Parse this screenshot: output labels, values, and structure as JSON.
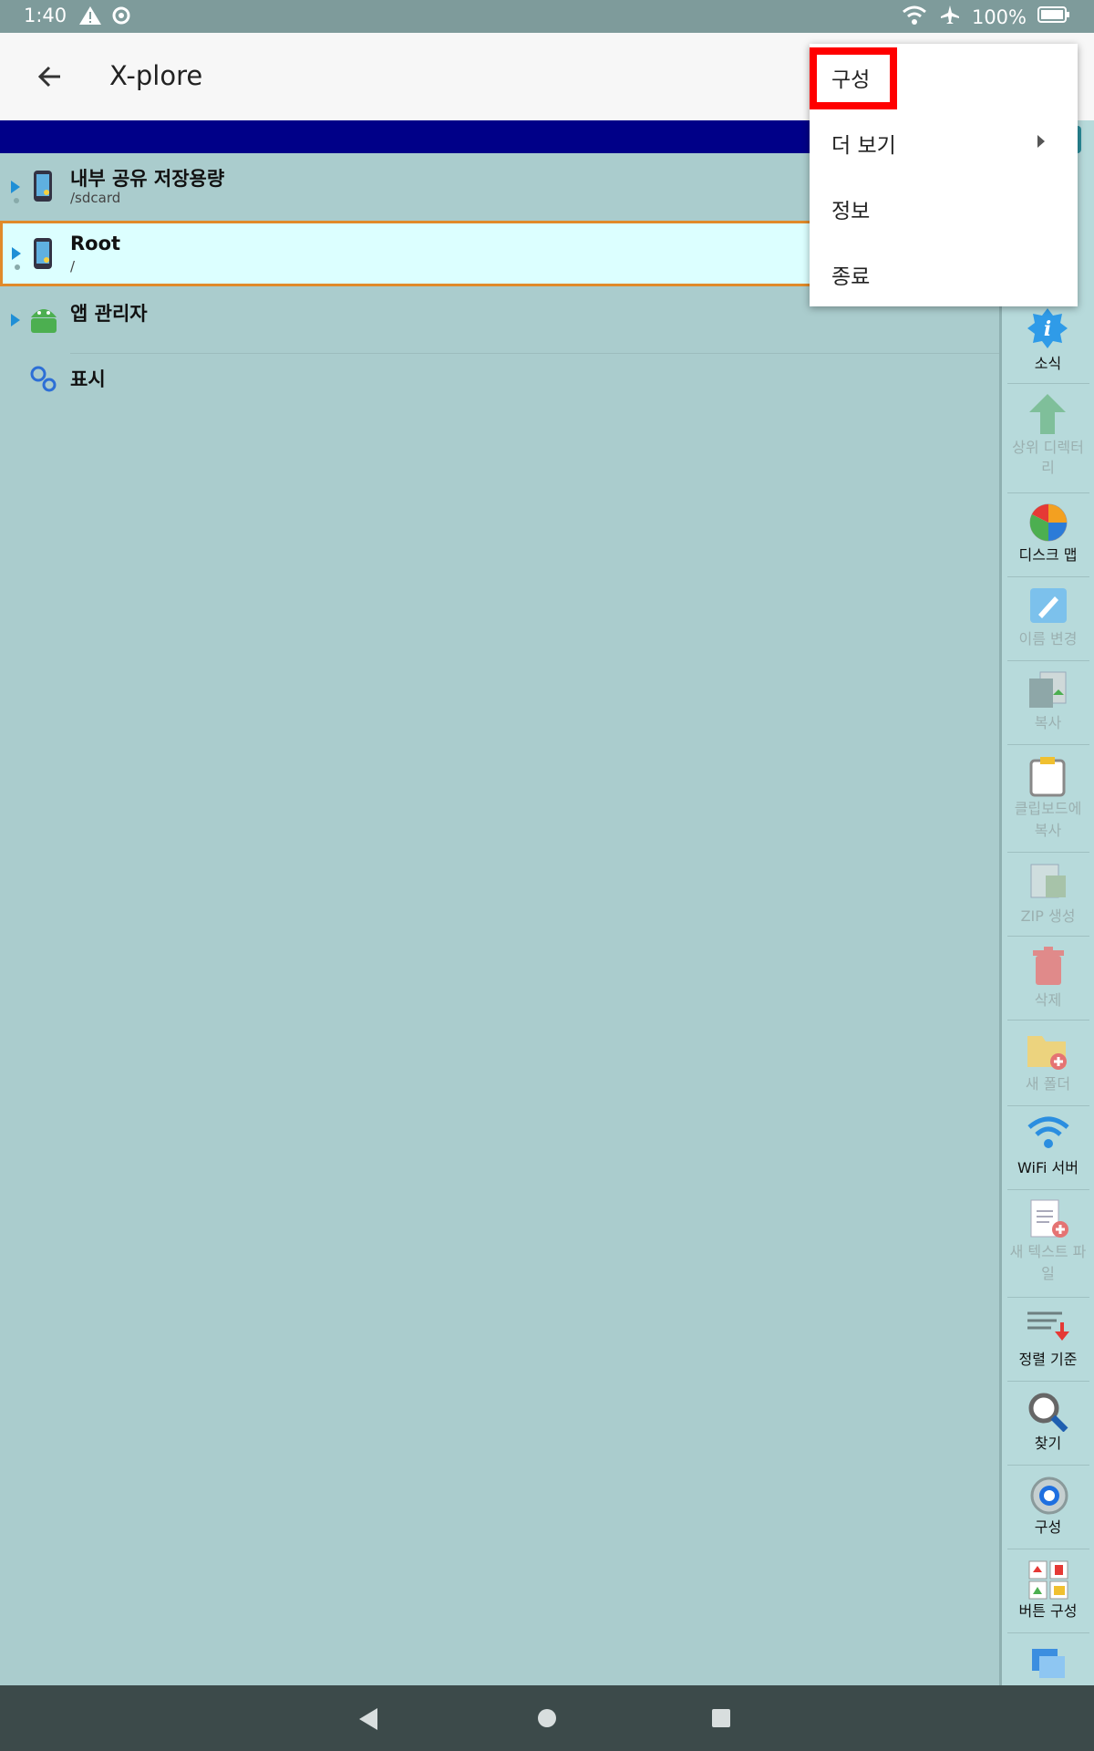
{
  "status": {
    "time": "1:40",
    "battery": "100%"
  },
  "app": {
    "title": "X-plore"
  },
  "list": [
    {
      "name": "내부 공유 저장용량",
      "sub": "/sdcard"
    },
    {
      "name": "Root",
      "sub": "/"
    },
    {
      "name": "앱 관리자"
    },
    {
      "name": "표시"
    }
  ],
  "menu": {
    "items": [
      "구성",
      "더 보기",
      "정보",
      "종료"
    ]
  },
  "toolbar": {
    "news": "소식",
    "parent_a": "상위 디렉터",
    "parent_b": "리",
    "disk_map": "디스크 맵",
    "rename": "이름 변경",
    "copy": "복사",
    "clip_a": "클립보드에",
    "clip_b": "복사",
    "zip": "ZIP 생성",
    "delete": "삭제",
    "new_folder": "새 폴더",
    "wifi": "WiFi 서버",
    "newtext_a": "새 텍스트 파",
    "newtext_b": "일",
    "sort": "정렬 기준",
    "find": "찾기",
    "config": "구성",
    "buttons": "버튼 구성"
  },
  "colors": {
    "accent_blue": "#000088",
    "selection": "#dcffff",
    "highlight": "#ff0000"
  }
}
